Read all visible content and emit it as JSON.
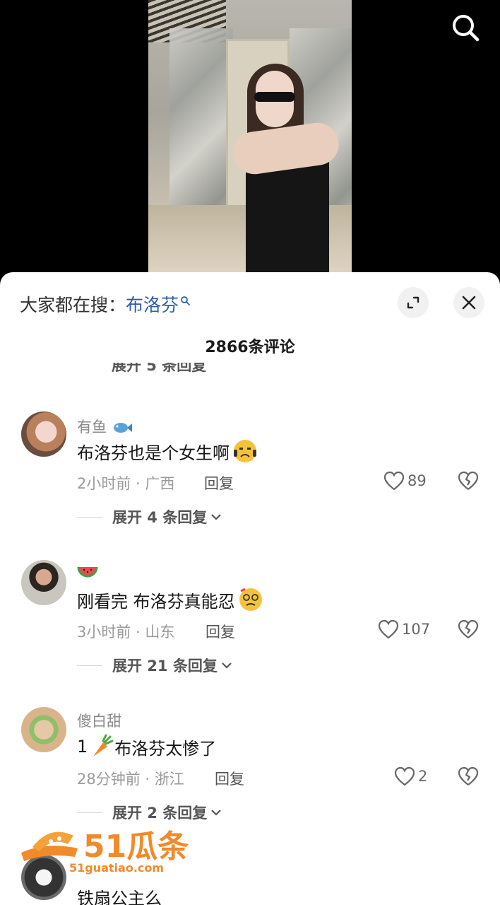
{
  "video": {
    "search_icon": "search-icon"
  },
  "sheet": {
    "hot_search_prefix": "大家都在搜：",
    "hot_search_term": "布洛芬",
    "comment_count": "2866条评论",
    "cut_reply": "展开 5 条回复",
    "colors": {
      "link": "#2a5ea8",
      "text": "#161616",
      "meta": "#9a9a9a"
    }
  },
  "comments": [
    {
      "username": "有鱼",
      "text": "布洛芬也是个女生啊",
      "time": "2小时前 · 广西",
      "reply": "回复",
      "likes": "89",
      "expand": "展开 4 条回复"
    },
    {
      "username": "",
      "text": "刚看完 布洛芬真能忍",
      "time": "3小时前 · 山东",
      "reply": "回复",
      "likes": "107",
      "expand": "展开 21 条回复"
    },
    {
      "username": "傻白甜",
      "text": "1",
      "text2": "布洛芬太惨了",
      "time": "28分钟前 · 浙江",
      "reply": "回复",
      "likes": "2",
      "expand": "展开 2 条回复"
    },
    {
      "username": "",
      "text": "铁扇公主么"
    }
  ],
  "watermark": {
    "brand": "51瓜条",
    "url": "51guatiao.com"
  }
}
